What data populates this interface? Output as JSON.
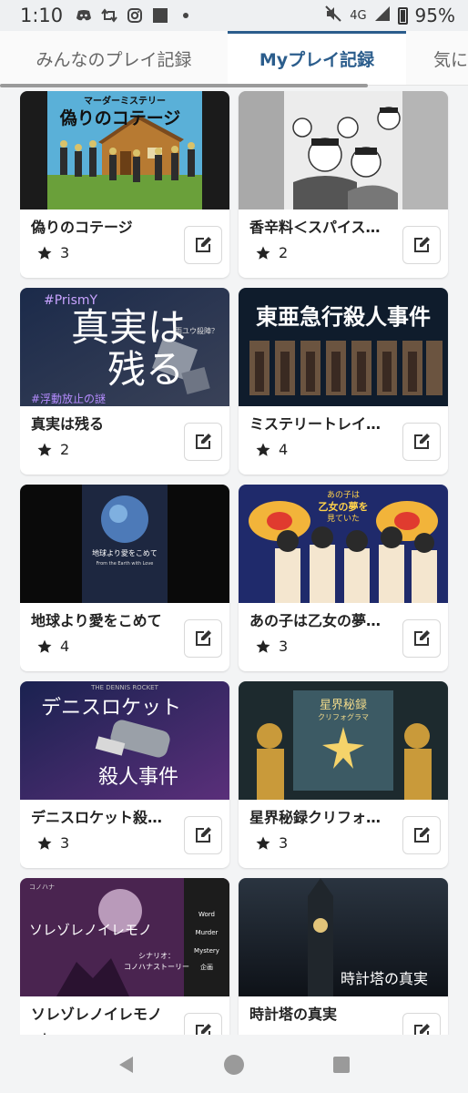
{
  "status_bar": {
    "time": "1:10",
    "network": "4G",
    "battery": "95%"
  },
  "tabs": [
    {
      "label": "みんなのプレイ記録",
      "active": false
    },
    {
      "label": "Myプレイ記録",
      "active": true
    },
    {
      "label": "気に",
      "active": false
    }
  ],
  "cards": [
    {
      "title": "偽りのコテージ",
      "rating": "3",
      "thumb_text": [
        "マーダーミステリー",
        "偽りのコテージ"
      ]
    },
    {
      "title": "香辛料＜スパイス…",
      "rating": "2",
      "thumb_text": []
    },
    {
      "title": "真実は残る",
      "rating": "2",
      "thumb_text": [
        "#PrismY",
        "真実は",
        "残る",
        "雨ユウ殺陣？",
        "#浮動放止の謎"
      ]
    },
    {
      "title": "ミステリートレイ…",
      "rating": "4",
      "thumb_text": [
        "東亜急行殺人事件"
      ]
    },
    {
      "title": "地球より愛をこめて",
      "rating": "4",
      "thumb_text": [
        "地球より愛をこめて",
        "From the Earth with Love"
      ]
    },
    {
      "title": "あの子は乙女の夢…",
      "rating": "3",
      "thumb_text": [
        "あの子は",
        "乙女の夢を",
        "見ていた"
      ]
    },
    {
      "title": "デニスロケット殺…",
      "rating": "3",
      "thumb_text": [
        "THE DENNIS ROCKET",
        "デニスロケット",
        "殺人事件"
      ]
    },
    {
      "title": "星界秘録クリフォ…",
      "rating": "3",
      "thumb_text": [
        "星界秘録",
        "クリフォグラマ"
      ]
    },
    {
      "title": "ソレゾレノイレモノ",
      "rating": "",
      "thumb_text": [
        "コノハナ",
        "ソレゾレノイレモノ",
        "Word",
        "Murder",
        "Mystery",
        "シナリオ：",
        "コノハナストーリー",
        "企画"
      ]
    },
    {
      "title": "時計塔の真実",
      "rating": "",
      "thumb_text": [
        "時計塔の真実"
      ]
    }
  ],
  "colors": {
    "accent": "#2b5d8c",
    "background": "#f3f4f5"
  }
}
